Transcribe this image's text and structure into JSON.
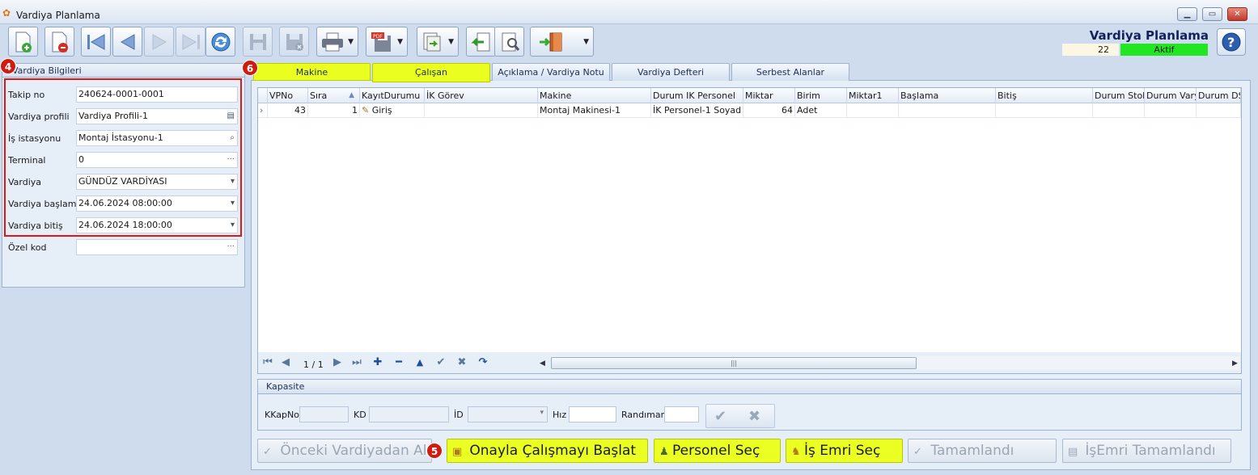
{
  "window": {
    "title": "Vardiya Planlama",
    "min": "▁",
    "max": "▭",
    "close": "✕"
  },
  "header": {
    "title": "Vardiya Planlama",
    "count": "22",
    "status": "Aktif",
    "status_color": "#22e622"
  },
  "toolbar": {
    "icons": [
      "new-record-icon",
      "delete-record-icon",
      "first-record-icon",
      "previous-record-icon",
      "next-record-icon",
      "last-record-icon",
      "refresh-icon",
      "save-icon",
      "save-close-icon",
      "print-icon",
      "pdf-export-icon",
      "export-icon",
      "back-icon",
      "settings-icon",
      "exit-icon"
    ]
  },
  "badges": {
    "b4": "4",
    "b5": "5",
    "b6": "6"
  },
  "left_panel": {
    "title": "Vardiya Bilgileri",
    "fields": [
      {
        "label": "Takip no",
        "value": "240624-0001-0001"
      },
      {
        "label": "Vardiya profili",
        "value": "Vardiya Profili-1"
      },
      {
        "label": "İş istasyonu",
        "value": "Montaj İstasyonu-1"
      },
      {
        "label": "Terminal",
        "value": "0"
      },
      {
        "label": "Vardiya",
        "value": "GÜNDÜZ VARDİYASI"
      },
      {
        "label": "Vardiya başlama",
        "value": "24.06.2024 08:00:00"
      },
      {
        "label": "Vardiya bitiş",
        "value": "24.06.2024 18:00:00"
      },
      {
        "label": "Özel kod",
        "value": ""
      }
    ]
  },
  "tabs": [
    "Makine",
    "Çalışan",
    "Açıklama / Vardiya Notu",
    "Vardiya Defteri",
    "Serbest Alanlar"
  ],
  "grid": {
    "columns": [
      "VPNo",
      "Sıra",
      "KayıtDurumu",
      "İK Görev",
      "Makine",
      "Durum IK Personel",
      "Miktar",
      "Birim",
      "Miktar1",
      "Başlama",
      "Bitiş",
      "Durum Stok",
      "Durum Varya",
      "Durum DST"
    ],
    "rows": [
      {
        "vpno": "43",
        "sira": "1",
        "kayit": "Giriş",
        "ik_gorev": "",
        "makine": "Montaj Makinesi-1",
        "personel": "İK Personel-1 Soyad",
        "miktar": "64",
        "birim": "Adet",
        "miktar1": "",
        "baslama": "",
        "bitis": "",
        "stok": "",
        "varya": "",
        "dst": ""
      }
    ],
    "pager": "1 / 1"
  },
  "kapasite": {
    "title": "Kapasite",
    "labels": [
      "KKapNo",
      "KD",
      "İD",
      "Hız",
      "Randıman"
    ]
  },
  "buttons": {
    "onceki": "Önceki Vardiyadan Al",
    "onayla": "Onayla Çalışmayı Başlat",
    "personel": "Personel Seç",
    "isemri": "İş Emri Seç",
    "tamamlandi": "Tamamlandı",
    "isemri_tamam": "İşEmri Tamamlandı"
  }
}
